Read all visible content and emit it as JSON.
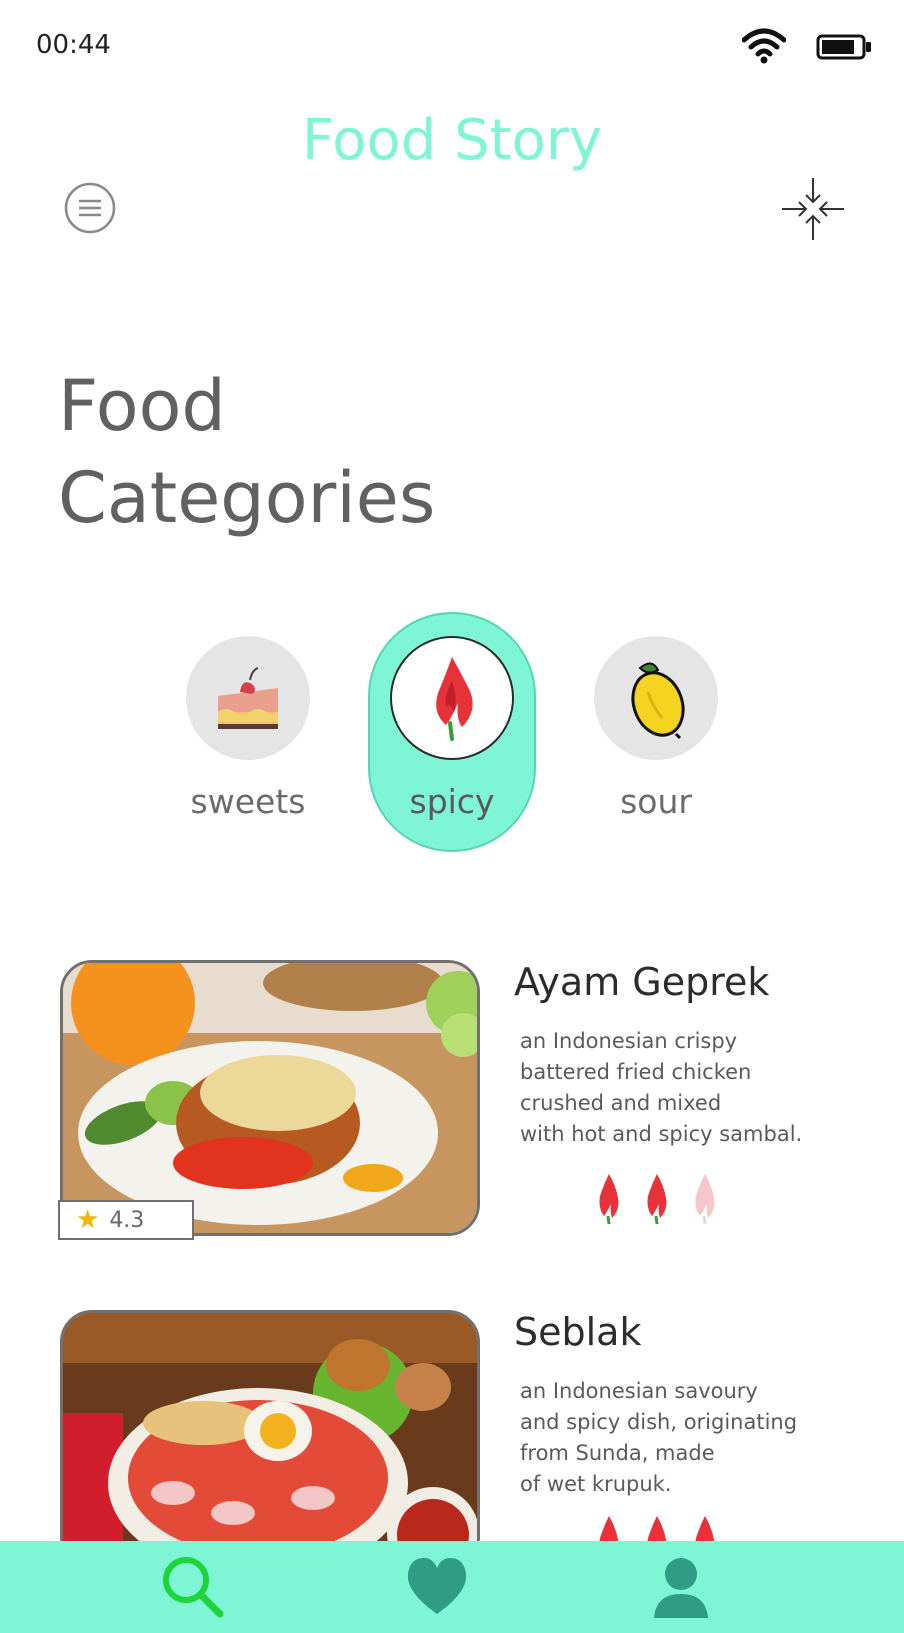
{
  "status_bar": {
    "time": "00:44",
    "wifi_icon": "wifi-icon",
    "battery_icon": "battery-icon"
  },
  "header": {
    "title": "Food Story",
    "menu_icon": "menu-icon",
    "collapse_icon": "collapse-arrows-icon"
  },
  "heading": {
    "line1": "Food",
    "line2": "Categories"
  },
  "categories": [
    {
      "label": "sweets",
      "icon": "cake-icon",
      "selected": false
    },
    {
      "label": "spicy",
      "icon": "chili-icon",
      "selected": true
    },
    {
      "label": "sour",
      "icon": "lemon-icon",
      "selected": false
    }
  ],
  "foods": [
    {
      "name": "Ayam Geprek",
      "description": "an Indonesian crispy\nbattered fried chicken\ncrushed and mixed\nwith hot and spicy sambal.",
      "rating": "4.3",
      "spice_level": 2,
      "spice_max": 3,
      "image": "ayam-geprek-photo"
    },
    {
      "name": "Seblak",
      "description": "an Indonesian savoury\nand spicy dish, originating\nfrom Sunda, made\nof wet krupuk.",
      "spice_level": 3,
      "spice_max": 3,
      "image": "seblak-photo"
    }
  ],
  "bottom_nav": [
    {
      "icon": "search-icon",
      "active": true
    },
    {
      "icon": "heart-icon",
      "active": false
    },
    {
      "icon": "profile-icon",
      "active": false
    }
  ],
  "colors": {
    "accent": "#7ef5d5",
    "chili": "#e8323a",
    "active_nav": "#1fd33a",
    "inactive_nav": "#2f9d83"
  }
}
